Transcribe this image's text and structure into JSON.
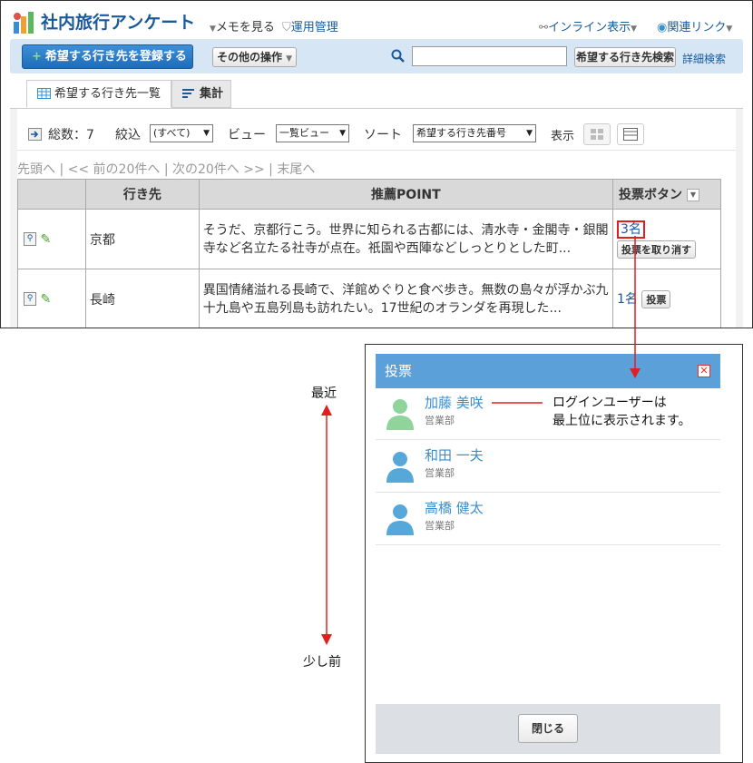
{
  "header": {
    "app_title": "社内旅行アンケート",
    "memo": "メモを見る",
    "admin": "運用管理",
    "inline_view": "インライン表示",
    "related_links": "関連リンク"
  },
  "toolbar": {
    "register_label": "希望する行き先を登録する",
    "other_actions": "その他の操作",
    "search_value": "",
    "search_button": "希望する行き先検索",
    "advanced_search": "詳細検索"
  },
  "tabs": [
    {
      "label": "希望する行き先一覧",
      "active": true
    },
    {
      "label": "集計",
      "active": false
    }
  ],
  "controls": {
    "total_label": "総数：7",
    "filter_label": "絞込",
    "filter_value": "(すべて)",
    "view_label": "ビュー",
    "view_value": "一覧ビュー",
    "sort_label": "ソート",
    "sort_value": "希望する行き先番号",
    "display_label": "表示"
  },
  "pager": {
    "first": "先頭へ",
    "prev": "<< 前の20件へ",
    "next": "次の20件へ >>",
    "last": "末尾へ"
  },
  "table": {
    "columns": [
      "",
      "行き先",
      "推薦POINT",
      "投票ボタン"
    ],
    "rows": [
      {
        "destination": "京都",
        "point": "そうだ、京都行こう。世界に知られる古都には、清水寺・金閣寺・銀閣寺など名立たる社寺が点在。祇園や西陣などしっとりとした町...",
        "count": "3名",
        "vote_button": "投票を取り消す"
      },
      {
        "destination": "長崎",
        "point": "異国情緒溢れる長崎で、洋館めぐりと食べ歩き。無数の島々が浮かぶ九十九島や五島列島も訪れたい。17世紀のオランダを再現した...",
        "count": "1名",
        "vote_button": "投票"
      }
    ]
  },
  "dialog": {
    "title": "投票",
    "voters": [
      {
        "name": "加藤 美咲",
        "dept": "営業部",
        "color": "#8fd49a"
      },
      {
        "name": "和田 一夫",
        "dept": "営業部",
        "color": "#55a8d8"
      },
      {
        "name": "高橋 健太",
        "dept": "営業部",
        "color": "#55a8d8"
      }
    ],
    "close_button": "閉じる"
  },
  "annotations": {
    "recent": "最近",
    "earlier": "少し前",
    "login_note_line1": "ログインユーザーは",
    "login_note_line2": "最上位に表示されます。"
  }
}
